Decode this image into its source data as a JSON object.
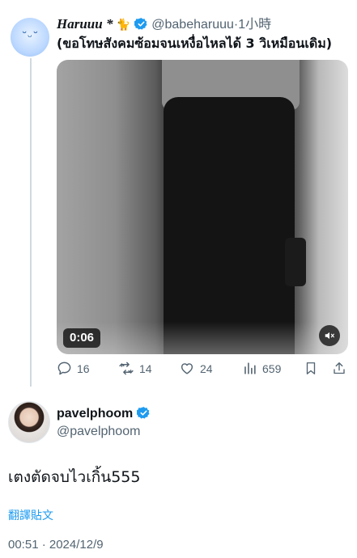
{
  "reply_to": {
    "display_name": "Haruuu *",
    "emoji": "🐈",
    "handle": "@babeharuuu",
    "time": "·1小時",
    "text": "(ขอโทษสังคมซ้อมจนเหงื่อไหลได้ 3 วิเหมือนเดิม)",
    "video": {
      "duration": "0:06"
    },
    "stats": {
      "replies": "16",
      "reposts": "14",
      "likes": "24",
      "views": "659"
    }
  },
  "tweet": {
    "display_name": "pavelphoom",
    "handle": "@pavelphoom",
    "text": "เตงตัดจบไวเกิ้น555",
    "translate_label": "翻譯貼文",
    "timestamp": "00:51 · 2024/12/9"
  },
  "colors": {
    "accent": "#1d9bf0",
    "muted": "#536471",
    "thread_line": "#cfd9de"
  },
  "icons": {
    "reply_to": [
      "verified-badge-icon",
      "mute-icon",
      "reply-icon",
      "repost-icon",
      "like-icon",
      "views-icon",
      "bookmark-icon",
      "share-icon"
    ],
    "tweet": [
      "verified-badge-icon"
    ]
  }
}
